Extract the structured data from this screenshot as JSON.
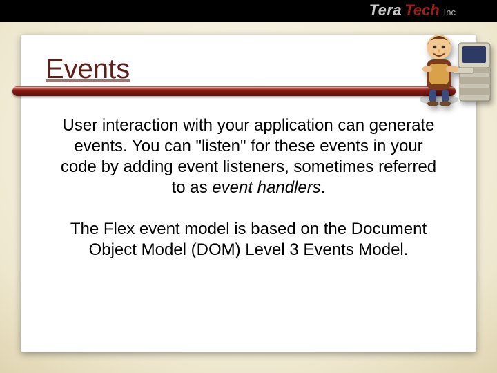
{
  "brand": {
    "tera": "Tera",
    "tech": "Tech",
    "inc": "Inc"
  },
  "title": "Events",
  "paragraphs": [
    {
      "pre": "User interaction with your application can generate events. You can \"listen\" for these events in your code by adding event listeners, sometimes referred to as ",
      "em": "event handlers",
      "post": "."
    },
    {
      "pre": "The Flex event model is based on the Document Object Model (DOM) Level 3 Events Model.",
      "em": "",
      "post": ""
    }
  ]
}
